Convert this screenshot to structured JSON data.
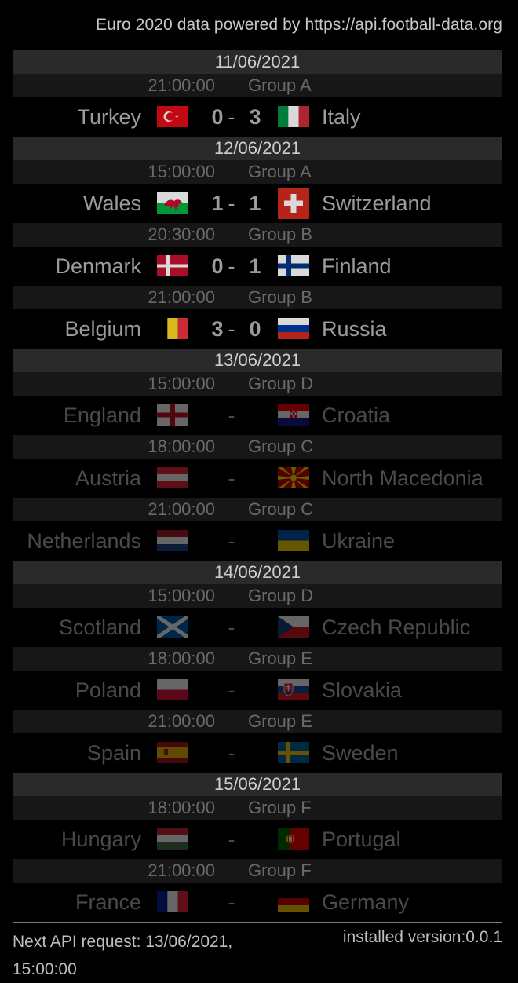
{
  "credit": "Euro 2020 data powered by https://api.football-data.org",
  "days": [
    {
      "date": "11/06/2021",
      "matches": [
        {
          "time": "21:00:00",
          "group": "Group A",
          "home": "Turkey",
          "home_flag": "turkey-flag",
          "away": "Italy",
          "away_flag": "italy-flag",
          "home_score": "0",
          "away_score": "3",
          "played": true
        }
      ]
    },
    {
      "date": "12/06/2021",
      "matches": [
        {
          "time": "15:00:00",
          "group": "Group A",
          "home": "Wales",
          "home_flag": "wales-flag",
          "away": "Switzerland",
          "away_flag": "switzerland-flag",
          "home_score": "1",
          "away_score": "1",
          "played": true
        },
        {
          "time": "20:30:00",
          "group": "Group B",
          "home": "Denmark",
          "home_flag": "denmark-flag",
          "away": "Finland",
          "away_flag": "finland-flag",
          "home_score": "0",
          "away_score": "1",
          "played": true
        },
        {
          "time": "21:00:00",
          "group": "Group B",
          "home": "Belgium",
          "home_flag": "belgium-flag",
          "away": "Russia",
          "away_flag": "russia-flag",
          "home_score": "3",
          "away_score": "0",
          "played": true
        }
      ]
    },
    {
      "date": "13/06/2021",
      "matches": [
        {
          "time": "15:00:00",
          "group": "Group D",
          "home": "England",
          "home_flag": "england-flag",
          "away": "Croatia",
          "away_flag": "croatia-flag",
          "home_score": "",
          "away_score": "",
          "played": false
        },
        {
          "time": "18:00:00",
          "group": "Group C",
          "home": "Austria",
          "home_flag": "austria-flag",
          "away": "North Macedonia",
          "away_flag": "north-macedonia-flag",
          "home_score": "",
          "away_score": "",
          "played": false
        },
        {
          "time": "21:00:00",
          "group": "Group C",
          "home": "Netherlands",
          "home_flag": "netherlands-flag",
          "away": "Ukraine",
          "away_flag": "ukraine-flag",
          "home_score": "",
          "away_score": "",
          "played": false
        }
      ]
    },
    {
      "date": "14/06/2021",
      "matches": [
        {
          "time": "15:00:00",
          "group": "Group D",
          "home": "Scotland",
          "home_flag": "scotland-flag",
          "away": "Czech Republic",
          "away_flag": "czech-republic-flag",
          "home_score": "",
          "away_score": "",
          "played": false
        },
        {
          "time": "18:00:00",
          "group": "Group E",
          "home": "Poland",
          "home_flag": "poland-flag",
          "away": "Slovakia",
          "away_flag": "slovakia-flag",
          "home_score": "",
          "away_score": "",
          "played": false
        },
        {
          "time": "21:00:00",
          "group": "Group E",
          "home": "Spain",
          "home_flag": "spain-flag",
          "away": "Sweden",
          "away_flag": "sweden-flag",
          "home_score": "",
          "away_score": "",
          "played": false
        }
      ]
    },
    {
      "date": "15/06/2021",
      "matches": [
        {
          "time": "18:00:00",
          "group": "Group F",
          "home": "Hungary",
          "home_flag": "hungary-flag",
          "away": "Portugal",
          "away_flag": "portugal-flag",
          "home_score": "",
          "away_score": "",
          "played": false
        },
        {
          "time": "21:00:00",
          "group": "Group F",
          "home": "France",
          "home_flag": "france-flag",
          "away": "Germany",
          "away_flag": "germany-flag",
          "home_score": "",
          "away_score": "",
          "played": false
        }
      ]
    }
  ],
  "dash": "-",
  "footer": {
    "next_api": "Next API request: 13/06/2021, 15:00:00",
    "version": "installed version:0.0.1"
  },
  "colors": {
    "background": "#000000",
    "date_bar": "#2a2a2a",
    "meta_bar": "#171717",
    "played_text": "#9b9b9b",
    "upcoming_text": "#4a4a4a"
  }
}
